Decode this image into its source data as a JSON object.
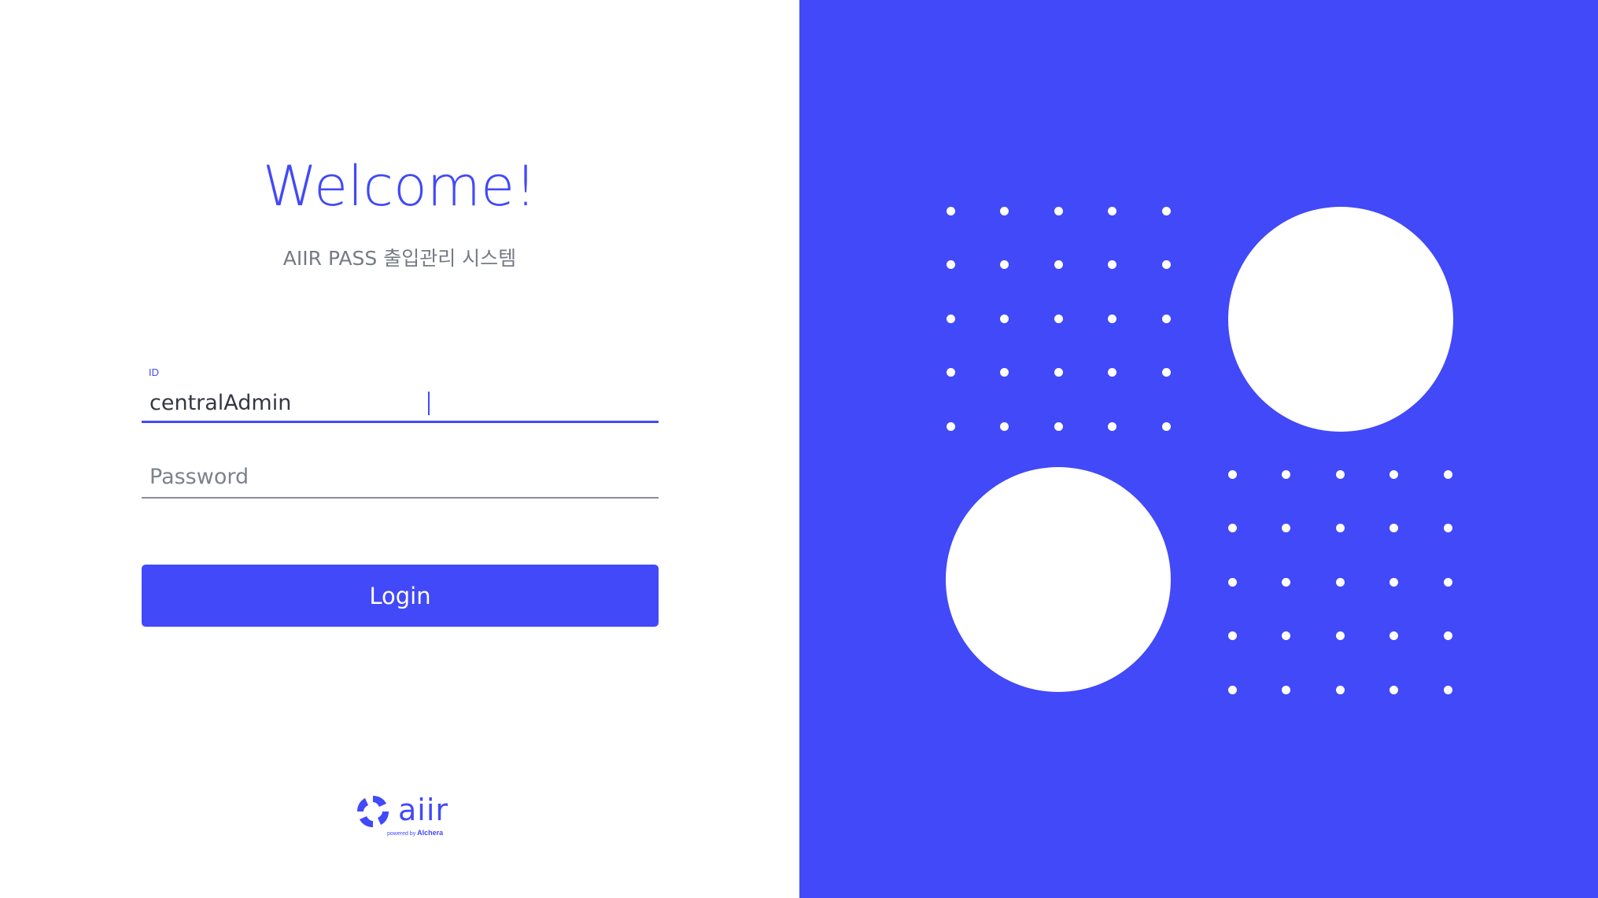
{
  "login": {
    "title": "Welcome!",
    "subtitle": "AIIR PASS 출입관리 시스템",
    "id_field": {
      "label": "ID",
      "value": "centralAdmin"
    },
    "password_field": {
      "placeholder": "Password",
      "value": ""
    },
    "login_button": "Login"
  },
  "logo": {
    "word": "aiir",
    "powered_by": "powered by",
    "brand": "Alchera"
  },
  "colors": {
    "accent": "#4249f8",
    "text_gray": "#757b85",
    "background": "#ffffff"
  },
  "decor": {
    "dot_grid_top_left": {
      "rows": 5,
      "cols": 5
    },
    "dot_grid_bottom_right": {
      "rows": 5,
      "cols": 5
    },
    "large_circles": 2
  }
}
